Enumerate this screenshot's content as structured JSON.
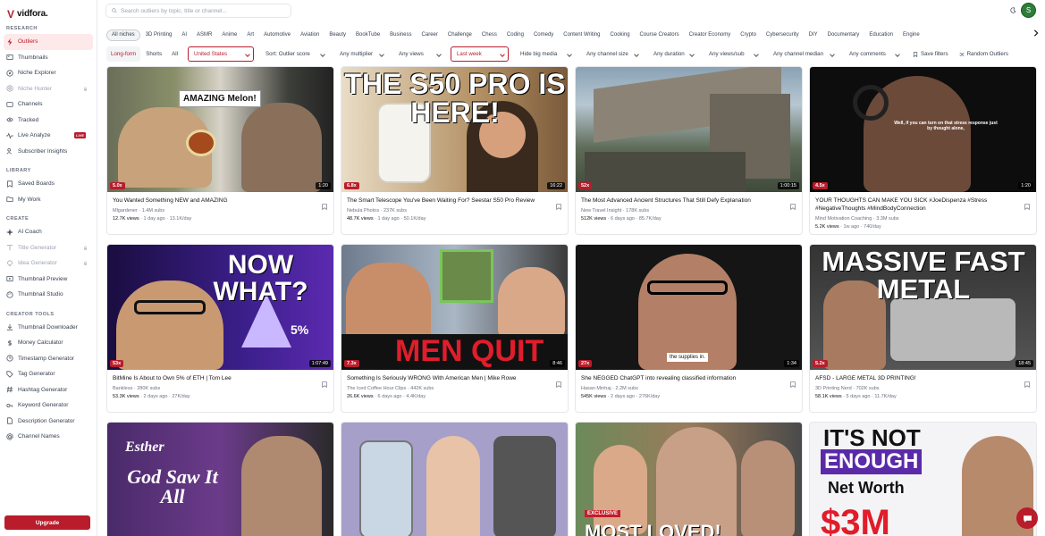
{
  "app": {
    "name": "vidfora."
  },
  "sidebar": {
    "sections": [
      {
        "title": "RESEARCH",
        "items": [
          {
            "label": "Outliers",
            "icon": "lightning-icon",
            "active": true
          },
          {
            "label": "Thumbnails",
            "icon": "image-icon"
          },
          {
            "label": "Niche Explorer",
            "icon": "compass-icon"
          },
          {
            "label": "Niche Hunter",
            "icon": "target-icon",
            "locked": true
          },
          {
            "label": "Channels",
            "icon": "tv-icon"
          },
          {
            "label": "Tracked",
            "icon": "eye-icon"
          },
          {
            "label": "Live Analyze",
            "icon": "pulse-icon",
            "badge": "LIVE"
          },
          {
            "label": "Subscriber Insights",
            "icon": "users-icon"
          }
        ]
      },
      {
        "title": "LIBRARY",
        "items": [
          {
            "label": "Saved Boards",
            "icon": "bookmark-icon"
          },
          {
            "label": "My Work",
            "icon": "folder-icon"
          }
        ]
      },
      {
        "title": "CREATE",
        "items": [
          {
            "label": "AI Coach",
            "icon": "sparkle-icon"
          },
          {
            "label": "Title Generator",
            "icon": "type-icon",
            "locked": true
          },
          {
            "label": "Idea Generator",
            "icon": "bulb-icon",
            "locked": true
          },
          {
            "label": "Thumbnail Preview",
            "icon": "preview-icon"
          },
          {
            "label": "Thumbnail Studio",
            "icon": "palette-icon"
          }
        ]
      },
      {
        "title": "CREATOR TOOLS",
        "items": [
          {
            "label": "Thumbnail Downloader",
            "icon": "download-icon"
          },
          {
            "label": "Money Calculator",
            "icon": "dollar-icon"
          },
          {
            "label": "Timestamp Generator",
            "icon": "clock-icon"
          },
          {
            "label": "Tag Generator",
            "icon": "tag-icon"
          },
          {
            "label": "Hashtag Generator",
            "icon": "hash-icon"
          },
          {
            "label": "Keyword Generator",
            "icon": "key-icon"
          },
          {
            "label": "Description Generator",
            "icon": "doc-icon"
          },
          {
            "label": "Channel Names",
            "icon": "at-icon"
          }
        ]
      }
    ],
    "upgrade_label": "Upgrade"
  },
  "header": {
    "search_placeholder": "Search outliers by topic, title or channel...",
    "avatar_letter": "S"
  },
  "niches": [
    "All niches",
    "3D Printing",
    "AI",
    "ASMR",
    "Anime",
    "Art",
    "Automotive",
    "Aviation",
    "Beauty",
    "BookTube",
    "Business",
    "Career",
    "Challenge",
    "Chess",
    "Coding",
    "Comedy",
    "Content Writing",
    "Cooking",
    "Course Creators",
    "Creator Economy",
    "Crypto",
    "Cybersecurity",
    "DIY",
    "Documentary",
    "Education",
    "Engine"
  ],
  "filters": {
    "format_tabs": [
      "Long-form",
      "Shorts",
      "All"
    ],
    "country": "United States",
    "sort": "Sort: Outlier score",
    "multiplier": "Any multiplier",
    "views": "Any views",
    "date": "Last week",
    "hide_big_media": "Hide big media",
    "channel_size": "Any channel size",
    "duration": "Any duration",
    "views_per_sub": "Any views/sub",
    "channel_median": "Any channel median",
    "comments": "Any comments",
    "save_filters": "Save filters",
    "random_outliers": "Random Outliers"
  },
  "videos": [
    {
      "title": "You Wanted Something NEW and AMAZING",
      "channel": "Mlgardener",
      "subs": "1.4M subs",
      "views": "12.7K views",
      "ago": "1 day ago",
      "rate": "13.1K/day",
      "mult": "5.0x",
      "duration": "1:20",
      "thumb_text": "AMAZING Melon!"
    },
    {
      "title": "The Smart Telescope You've Been Waiting For? Seestar S50 Pro Review",
      "channel": "Nebula Photos",
      "subs": "237K subs",
      "views": "48.7K views",
      "ago": "1 day ago",
      "rate": "50.1K/day",
      "mult": "6.8x",
      "duration": "16:22",
      "thumb_text": "THE S50 PRO IS HERE!"
    },
    {
      "title": "The Most Advanced Ancient Structures That Still Defy Explanation",
      "channel": "New Travel Insight",
      "subs": "178K subs",
      "views": "512K views",
      "ago": "6 days ago",
      "rate": "85.7K/day",
      "mult": "52x",
      "duration": "1:00:15",
      "thumb_text": ""
    },
    {
      "title": "YOUR THOUGHTS CAN MAKE YOU SICK #JoeDispenza #Stress #NegativeThoughts #MindBodyConnection",
      "channel": "Mind Motivation Coaching",
      "subs": "3.3M subs",
      "views": "5.2K views",
      "ago": "1w ago",
      "rate": "740/day",
      "mult": "4.5x",
      "duration": "1:20",
      "thumb_text": "Well, if you can turn on that stress response just by thought alone,"
    },
    {
      "title": "BitMine Is About to Own 5% of ETH | Tom Lee",
      "channel": "Bankless",
      "subs": "280K subs",
      "views": "53.3K views",
      "ago": "2 days ago",
      "rate": "27K/day",
      "mult": "53x",
      "duration": "1:07:49",
      "thumb_text": "NOW WHAT?",
      "thumb_sub": "5%"
    },
    {
      "title": "Something Is Seriously WRONG With American Men | Mike Rowe",
      "channel": "The Iced Coffee Hour Clips",
      "subs": "442K subs",
      "views": "26.6K views",
      "ago": "6 days ago",
      "rate": "4.4K/day",
      "mult": "7.3x",
      "duration": "8:46",
      "thumb_text": "MEN QUIT"
    },
    {
      "title": "She NEGGED ChatGPT into revealing classified information",
      "channel": "Hasan Minhaj",
      "subs": "2.2M subs",
      "views": "545K views",
      "ago": "2 days ago",
      "rate": "276K/day",
      "mult": "27x",
      "duration": "1:34",
      "thumb_text": "the supplies in."
    },
    {
      "title": "AFSD - LARGE METAL 3D PRINTING!",
      "channel": "3D Printing Nerd",
      "subs": "702K subs",
      "views": "58.1K views",
      "ago": "5 days ago",
      "rate": "11.7K/day",
      "mult": "5.2x",
      "duration": "18:45",
      "thumb_text": "MASSIVE FAST METAL"
    },
    {
      "title": "",
      "thumb_text": "Esther",
      "thumb_sub": "God Saw It All"
    },
    {
      "title": "",
      "thumb_text": ""
    },
    {
      "title": "",
      "thumb_text": "EXCLUSIVE",
      "thumb_sub": "MOST LOVED!"
    },
    {
      "title": "",
      "thumb_text": "IT'S NOT",
      "thumb_sub": "ENOUGH",
      "thumb_sub2": "Net Worth",
      "thumb_sub3": "$3M"
    }
  ]
}
